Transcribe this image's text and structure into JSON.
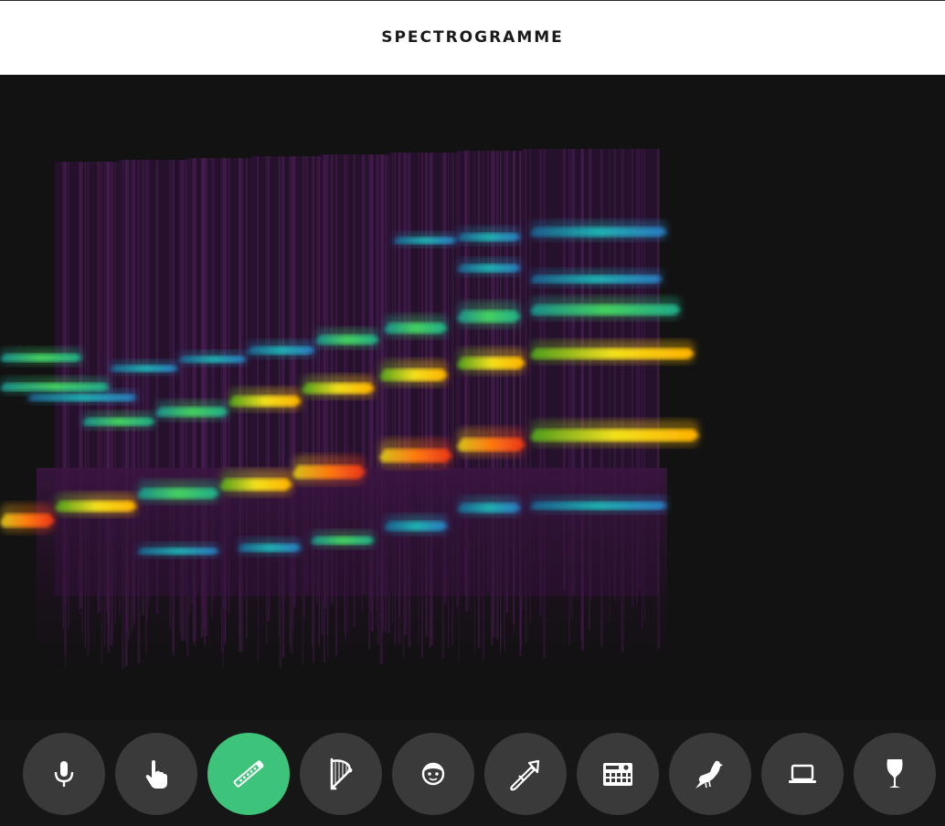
{
  "header": {
    "title": "SPECTROGRAMME"
  },
  "colors": {
    "header_bg": "#ffffff",
    "viz_bg": "#121212",
    "toolbar_bg": "#161616",
    "button_bg": "#3a3a3a",
    "button_active": "#3ec47a",
    "icon": "#ffffff"
  },
  "toolbar": {
    "buttons": [
      {
        "icon": "microphone-icon",
        "active": false
      },
      {
        "icon": "hand-pointer-icon",
        "active": false
      },
      {
        "icon": "flute-icon",
        "active": true
      },
      {
        "icon": "harp-icon",
        "active": false
      },
      {
        "icon": "face-icon",
        "active": false
      },
      {
        "icon": "trombone-icon",
        "active": false
      },
      {
        "icon": "drum-machine-icon",
        "active": false
      },
      {
        "icon": "bird-icon",
        "active": false
      },
      {
        "icon": "laptop-icon",
        "active": false
      },
      {
        "icon": "wine-glass-icon",
        "active": false
      }
    ]
  }
}
